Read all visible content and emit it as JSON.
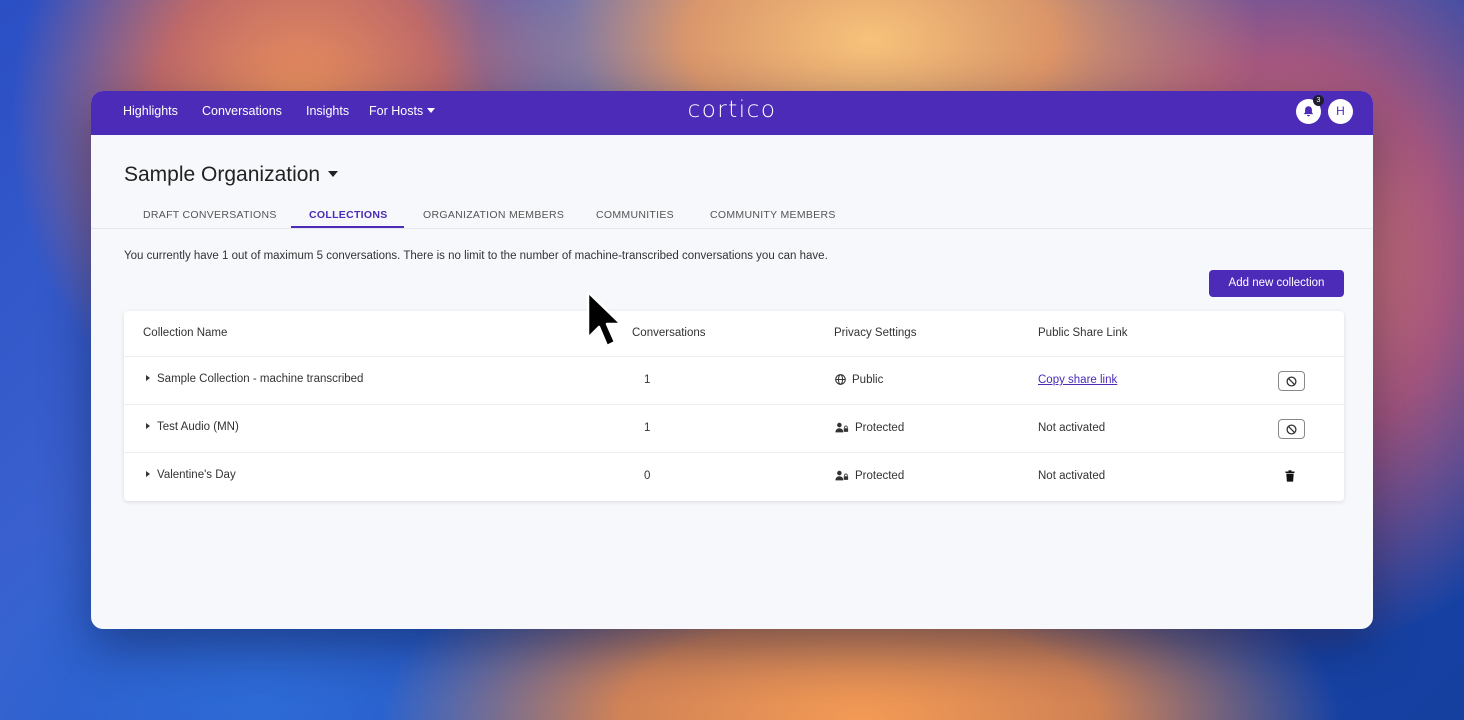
{
  "nav": {
    "highlights": "Highlights",
    "conversations": "Conversations",
    "insights": "Insights",
    "for_hosts": "For Hosts",
    "logo": "cortico",
    "notification_count": "3",
    "avatar_initial": "H"
  },
  "page": {
    "org_title": "Sample Organization",
    "tabs": [
      {
        "label": "DRAFT CONVERSATIONS"
      },
      {
        "label": "COLLECTIONS"
      },
      {
        "label": "ORGANIZATION MEMBERS"
      },
      {
        "label": "COMMUNITIES"
      },
      {
        "label": "COMMUNITY MEMBERS"
      }
    ],
    "active_tab": "COLLECTIONS",
    "info_text": "You currently have 1 out of maximum 5 conversations. There is no limit to the number of machine-transcribed conversations you can have.",
    "add_button": "Add new collection"
  },
  "table": {
    "headers": {
      "name": "Collection Name",
      "conversations": "Conversations",
      "privacy": "Privacy Settings",
      "share": "Public Share Link"
    },
    "rows": [
      {
        "name": "Sample Collection - machine transcribed",
        "conversations": "1",
        "privacy": "Public",
        "privacy_icon": "globe-icon",
        "share": "Copy share link",
        "action_icon": "ban-icon"
      },
      {
        "name": "Test Audio (MN)",
        "conversations": "1",
        "privacy": "Protected",
        "privacy_icon": "user-lock-icon",
        "share": "Not activated",
        "action_icon": "ban-icon"
      },
      {
        "name": "Valentine's Day",
        "conversations": "0",
        "privacy": "Protected",
        "privacy_icon": "user-lock-icon",
        "share": "Not activated",
        "action_icon": "trash-icon"
      }
    ]
  },
  "colors": {
    "brand": "#4b2bb8",
    "page_bg": "#f6f8fb"
  }
}
